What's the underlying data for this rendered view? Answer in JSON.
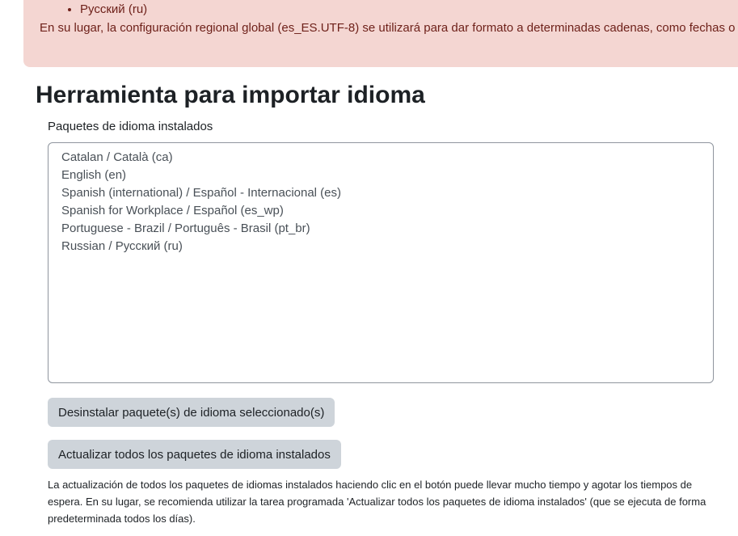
{
  "alert": {
    "list_item": "Русский (ru)",
    "message": "En su lugar, la configuración regional global (es_ES.UTF-8) se utilizará para dar formato a determinadas cadenas, como fechas o"
  },
  "title": "Herramienta para importar idioma",
  "installed_label": "Paquetes de idioma instalados",
  "installed_packs": [
    "Catalan / Català (ca)",
    "English (en)",
    "Spanish (international) / Español - Internacional (es)",
    "Spanish for Workplace / Español (es_wp)",
    "Portuguese - Brazil / Português - Brasil (pt_br)",
    "Russian / Русский (ru)"
  ],
  "uninstall_button": "Desinstalar paquete(s) de idioma seleccionado(s)",
  "update_button": "Actualizar todos los paquetes de idioma instalados",
  "note": "La actualización de todos los paquetes de idiomas instalados haciendo clic en el botón puede llevar mucho tiempo y agotar los tiempos de espera. En su lugar, se recomienda utilizar la tarea programada 'Actualizar todos los paquetes de idioma instalados' (que se ejecuta de forma predeterminada todos los días)."
}
